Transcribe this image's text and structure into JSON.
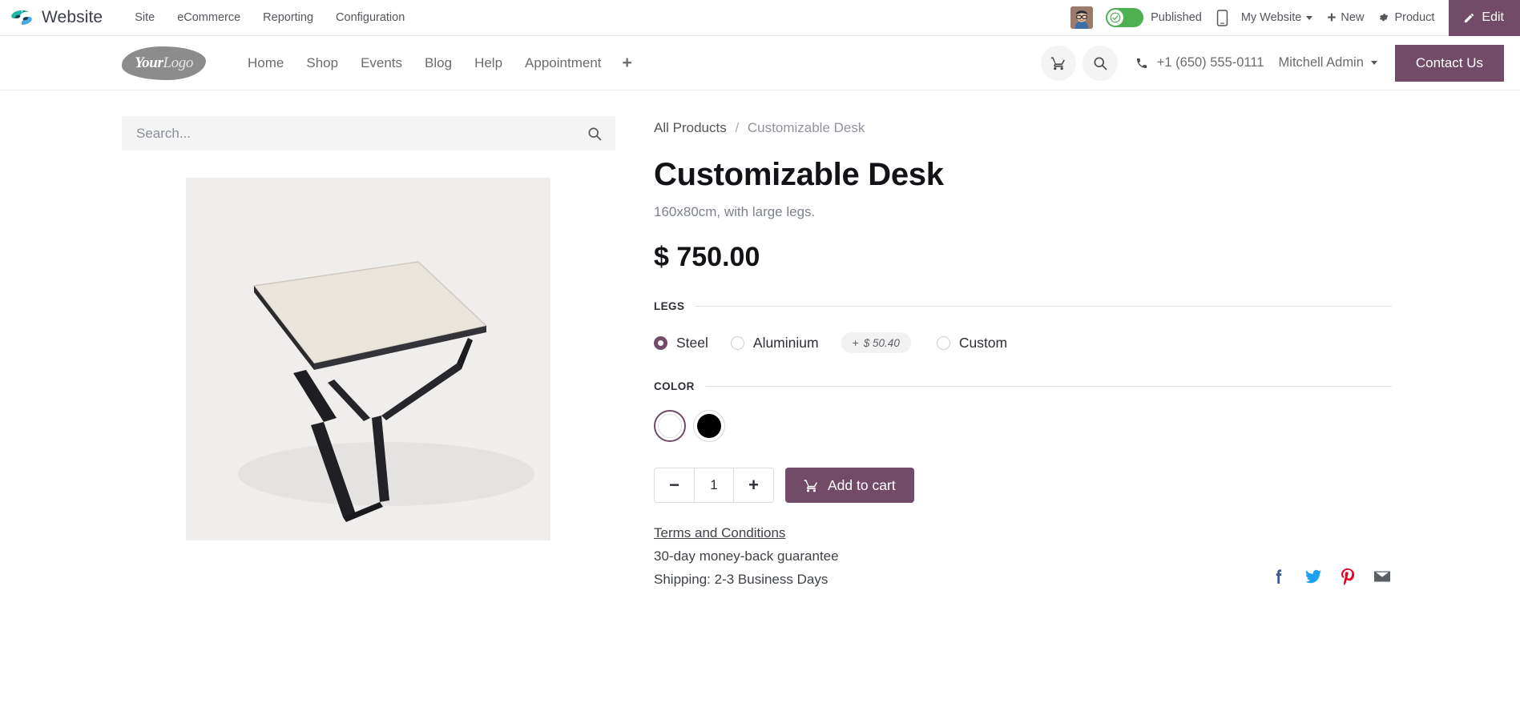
{
  "backend": {
    "app_name": "Website",
    "menus": [
      "Site",
      "eCommerce",
      "Reporting",
      "Configuration"
    ],
    "published_label": "Published",
    "site_selector": "My Website",
    "new_label": "New",
    "product_label": "Product",
    "edit_label": "Edit",
    "accent_color": "#714b67",
    "published_color": "#4caf50"
  },
  "site_header": {
    "logo_primary": "Your",
    "logo_secondary": "Logo",
    "nav": [
      "Home",
      "Shop",
      "Events",
      "Blog",
      "Help",
      "Appointment"
    ],
    "nav_add": "+",
    "phone": "+1 (650) 555-0111",
    "user": "Mitchell Admin",
    "contact_label": "Contact Us"
  },
  "search": {
    "placeholder": "Search...",
    "value": ""
  },
  "breadcrumb": {
    "parent": "All Products",
    "separator": "/",
    "current": "Customizable Desk"
  },
  "product": {
    "title": "Customizable Desk",
    "subtitle": "160x80cm, with large legs.",
    "price": "$ 750.00",
    "attributes": [
      {
        "label": "LEGS",
        "type": "radio",
        "options": [
          {
            "name": "Steel",
            "selected": true,
            "extra_price": null
          },
          {
            "name": "Aluminium",
            "selected": false,
            "extra_price": "$ 50.40",
            "extra_prefix": "+"
          },
          {
            "name": "Custom",
            "selected": false,
            "extra_price": null
          }
        ]
      },
      {
        "label": "COLOR",
        "type": "swatch",
        "options": [
          {
            "name": "White",
            "color": "#ffffff",
            "selected": true
          },
          {
            "name": "Black",
            "color": "#000000",
            "selected": false
          }
        ]
      }
    ],
    "quantity": "1",
    "add_to_cart_label": "Add to cart"
  },
  "footer": {
    "terms_label": "Terms and Conditions",
    "guarantee": "30-day money-back guarantee",
    "shipping": "Shipping: 2-3 Business Days",
    "social": [
      "facebook-icon",
      "twitter-icon",
      "pinterest-icon",
      "email-icon"
    ]
  }
}
